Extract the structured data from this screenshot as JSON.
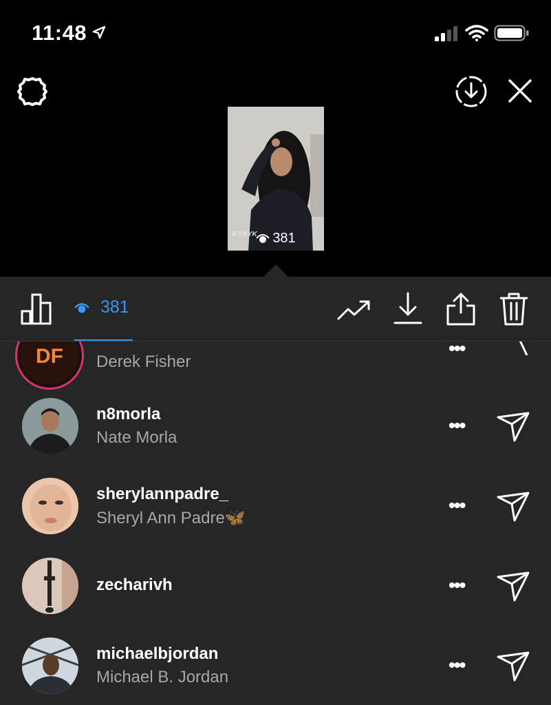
{
  "status_bar": {
    "time": "11:48"
  },
  "story": {
    "view_count": "381",
    "watermark": "IFYKYK"
  },
  "toolbar": {
    "views_count": "381",
    "accent_color": "#3897f0"
  },
  "viewers": [
    {
      "username": "",
      "full_name": "Derek Fisher",
      "avatar": "brand-logo"
    },
    {
      "username": "n8morla",
      "full_name": "Nate Morla",
      "avatar": "photo"
    },
    {
      "username": "sherylannpadre_",
      "full_name": "Sheryl Ann Padre🦋",
      "avatar": "photo"
    },
    {
      "username": "zecharivh",
      "full_name": "",
      "avatar": "photo"
    },
    {
      "username": "michaelbjordan",
      "full_name": "Michael B. Jordan",
      "avatar": "photo"
    }
  ],
  "icons": {
    "settings": "gear-icon",
    "save": "download-circle-icon",
    "close": "close-icon",
    "stats": "bar-chart-icon",
    "views": "eye-icon",
    "trend": "trending-icon",
    "download": "download-icon",
    "share": "share-icon",
    "delete": "trash-icon",
    "more": "more-icon",
    "send": "send-icon"
  }
}
